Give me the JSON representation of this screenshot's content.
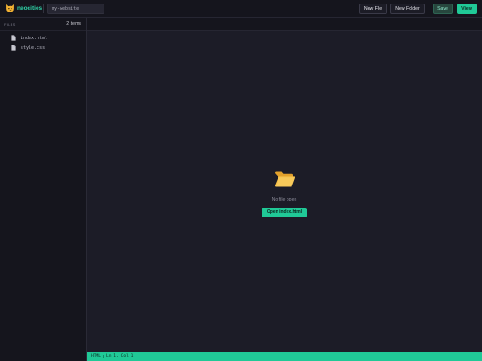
{
  "app": {
    "name": "neocities",
    "site_name": "my-website",
    "accent_color": "#20c997"
  },
  "toolbar": {
    "new_file_label": "New File",
    "new_folder_label": "New Folder",
    "save_label": "Save",
    "view_label": "View"
  },
  "sidebar": {
    "files_label": "FILES",
    "count_label": "2 items",
    "files": [
      {
        "name": "index.html",
        "icon": "file-icon"
      },
      {
        "name": "style.css",
        "icon": "file-icon"
      }
    ]
  },
  "editor": {
    "empty_icon": "open-folder-icon",
    "empty_message": "No file open",
    "open_button_label": "Open index.html"
  },
  "status": {
    "language": "HTML",
    "position": "Ln 1, Col 1"
  }
}
